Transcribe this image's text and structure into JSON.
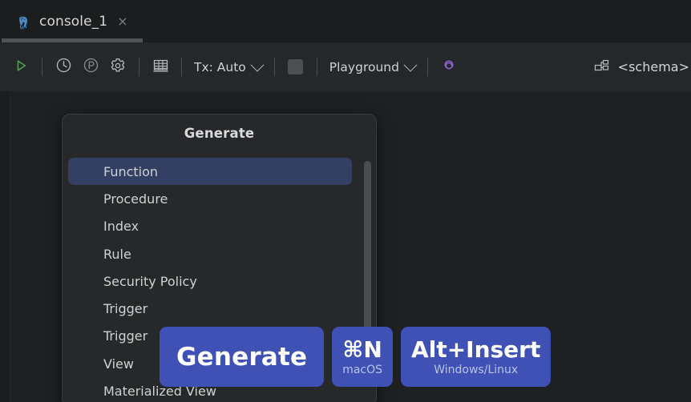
{
  "window": {
    "tab": {
      "icon": "postgres-elephant-icon",
      "label": "console_1",
      "close": "×"
    }
  },
  "toolbar": {
    "execute_icon": "play-triangle-icon",
    "history_icon": "clock-icon",
    "profile_icon": "circled-p-icon",
    "settings_icon": "gear-icon",
    "grid_icon": "table-grid-icon",
    "tx_label": "Tx: Auto",
    "tx_caret_icon": "chevron-down-icon",
    "color_chip_name": "session-color-chip",
    "session_label": "Playground",
    "session_caret_icon": "chevron-down-icon",
    "ai_icon": "ai-spiral-icon",
    "ai_color": "#8e62d4",
    "schema_icon": "schema-nodes-icon",
    "schema_label": "<schema>"
  },
  "popup": {
    "title": "Generate",
    "selected_index": 0,
    "items": [
      {
        "label": "Function"
      },
      {
        "label": "Procedure"
      },
      {
        "label": "Index"
      },
      {
        "label": "Rule"
      },
      {
        "label": "Security Policy"
      },
      {
        "label": "Trigger"
      },
      {
        "label": "Trigger"
      },
      {
        "label": "View"
      },
      {
        "label": "Materialized View"
      }
    ],
    "scrollbar_name": "popup-scrollbar"
  },
  "badges": [
    {
      "name": "action-badge",
      "top": "Generate",
      "sub": ""
    },
    {
      "name": "mac-shortcut-badge",
      "top": "⌘N",
      "sub": "macOS"
    },
    {
      "name": "win-shortcut-badge",
      "top": "Alt+Insert",
      "sub": "Windows/Linux"
    }
  ],
  "colors": {
    "accent_blue": "#3f51b5",
    "selection_blue": "#333f63",
    "editor_bg": "#1e2022",
    "toolbar_bg": "#25282a",
    "popup_bg": "#26282a",
    "run_green": "#4f9d53"
  }
}
